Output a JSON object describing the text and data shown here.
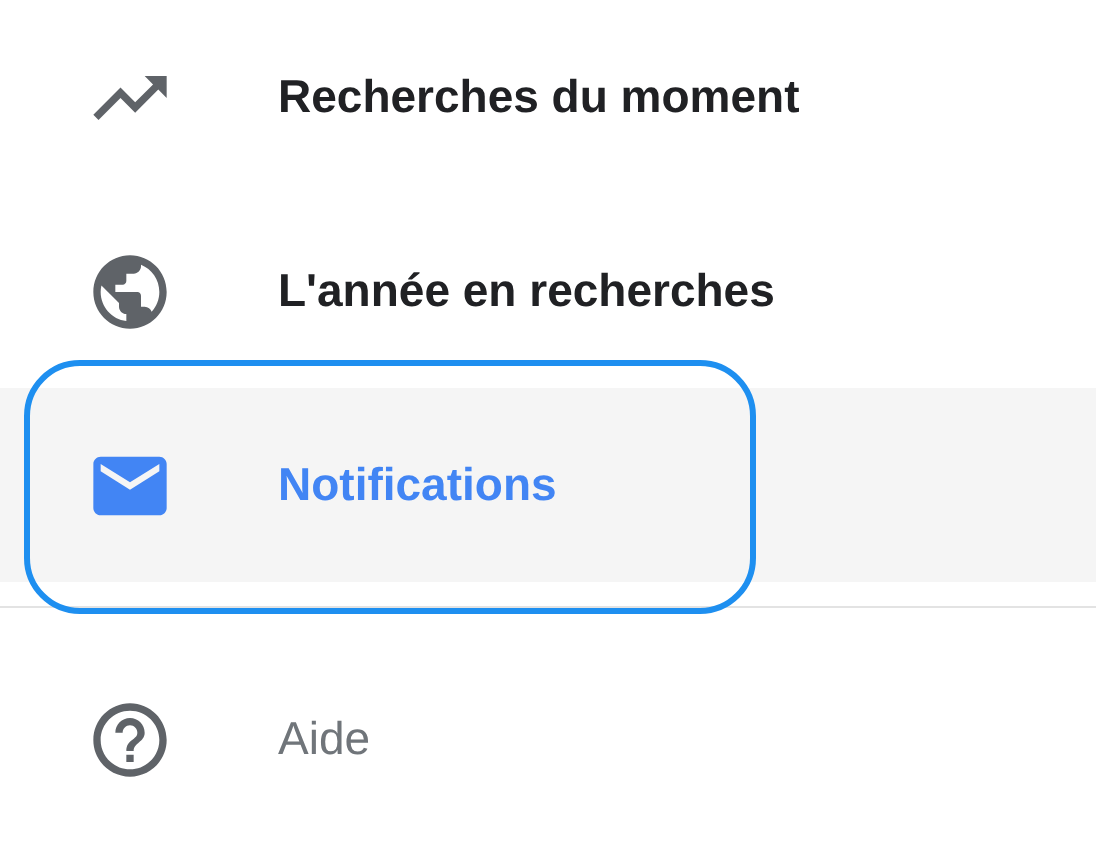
{
  "menu": {
    "items": [
      {
        "label": "Recherches du moment",
        "selected": false,
        "highlighted": false
      },
      {
        "label": "L'année en recherches",
        "selected": false,
        "highlighted": false
      },
      {
        "label": "Notifications",
        "selected": true,
        "highlighted": true
      }
    ]
  },
  "footer_items": [
    {
      "label": "Aide",
      "selected": false
    }
  ]
}
